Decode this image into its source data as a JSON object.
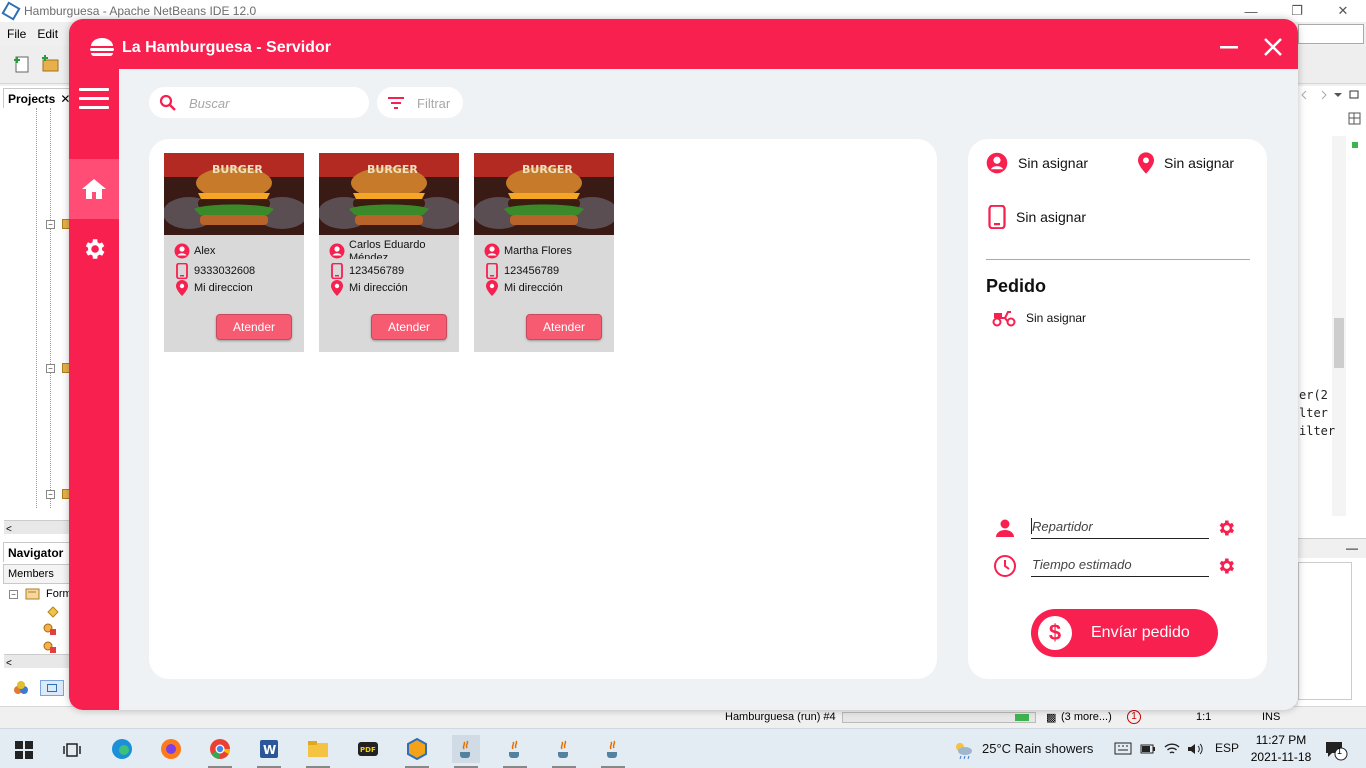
{
  "ide": {
    "title": "Hamburguesa - Apache NetBeans IDE 12.0",
    "menu": [
      "File",
      "Edit"
    ],
    "projects_tab": "Projects",
    "navigator_tab": "Navigator",
    "members_label": "Members",
    "tree_form": "Form",
    "code_lines": [
      "er(2",
      "lter",
      "ilter"
    ],
    "status": {
      "run_label": "Hamburguesa (run) #4",
      "more": "(3 more...)",
      "notifications": "1",
      "position": "1:1",
      "mode": "INS"
    }
  },
  "taskbar": {
    "weather": "25°C  Rain showers",
    "lang": "ESP",
    "time": "11:27 PM",
    "date": "2021-11-18",
    "notif_count": "1"
  },
  "app": {
    "title": "La Hamburguesa - Servidor",
    "search_placeholder": "Buscar",
    "filter_label": "Filtrar",
    "colors": {
      "primary": "#f7204f",
      "card_bg": "#d9d9d9",
      "button": "#f75b72"
    },
    "orders": [
      {
        "name": "Alex",
        "phone": "9333032608",
        "address": "Mi direccion",
        "button": "Atender"
      },
      {
        "name": "Carlos Eduardo Méndez",
        "phone": "123456789",
        "address": "Mi dirección",
        "button": "Atender"
      },
      {
        "name": "Martha Flores",
        "phone": "123456789",
        "address": "Mi dirección",
        "button": "Atender"
      }
    ],
    "detail": {
      "customer": "Sin asignar",
      "address": "Sin asignar",
      "phone": "Sin asignar",
      "heading": "Pedido",
      "delivery": "Sin asignar",
      "repartidor_placeholder": "Repartidor",
      "tiempo_placeholder": "Tiempo estimado",
      "send_button": "Envíar pedido"
    }
  }
}
